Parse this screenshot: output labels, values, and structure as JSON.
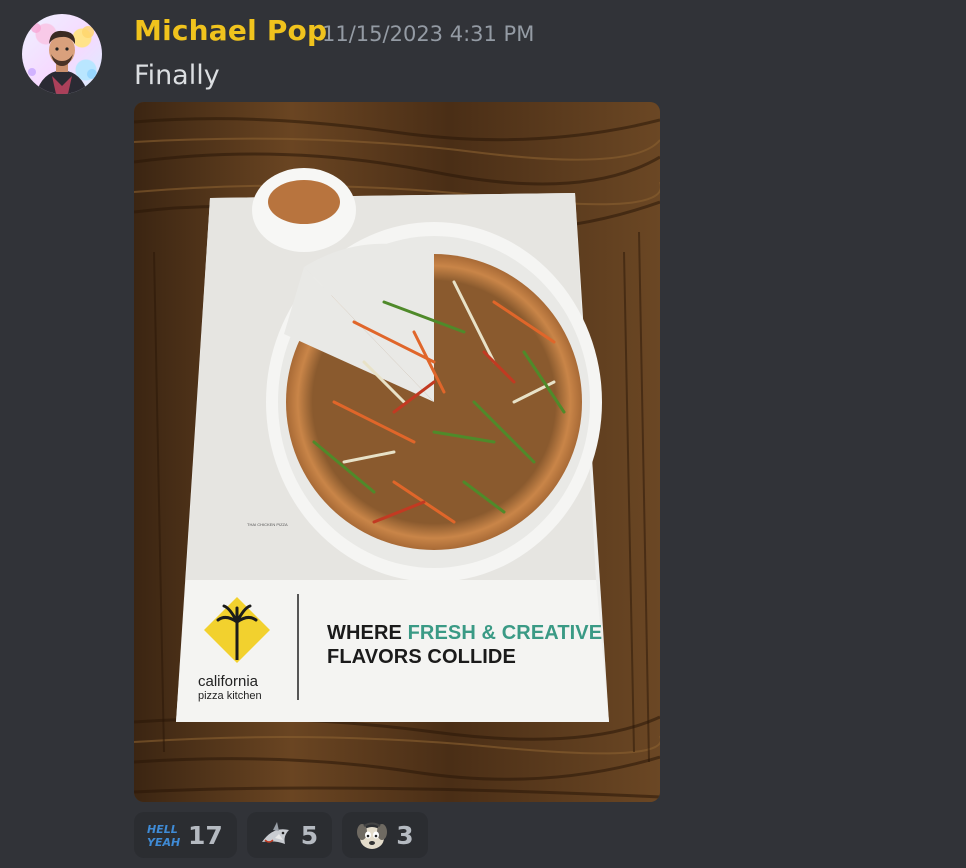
{
  "message": {
    "author": "Michael Pop",
    "timestamp": "11/15/2023 4:31 PM",
    "text": "Finally",
    "author_color": "#f0c31d"
  },
  "attachment": {
    "menu_title_line1_dark": "WHERE ",
    "menu_title_line1_accent": "FRESH & CREATIVE",
    "menu_title_line2": "FLAVORS COLLIDE",
    "brand_name": "california",
    "brand_sub": "pizza kitchen",
    "pizza_caption": "THAI CHICKEN PIZZA",
    "accent_color": "#3a9a85"
  },
  "reactions": [
    {
      "emoji": "hell-yeah-emoji",
      "emoji_text": "HELL YEAH",
      "count": "17"
    },
    {
      "emoji": "shark-emoji",
      "count": "5"
    },
    {
      "emoji": "gromit-emoji",
      "count": "3"
    }
  ],
  "colors": {
    "background": "#313338",
    "reaction_bg": "#2b2d31",
    "timestamp": "#949ba4"
  }
}
